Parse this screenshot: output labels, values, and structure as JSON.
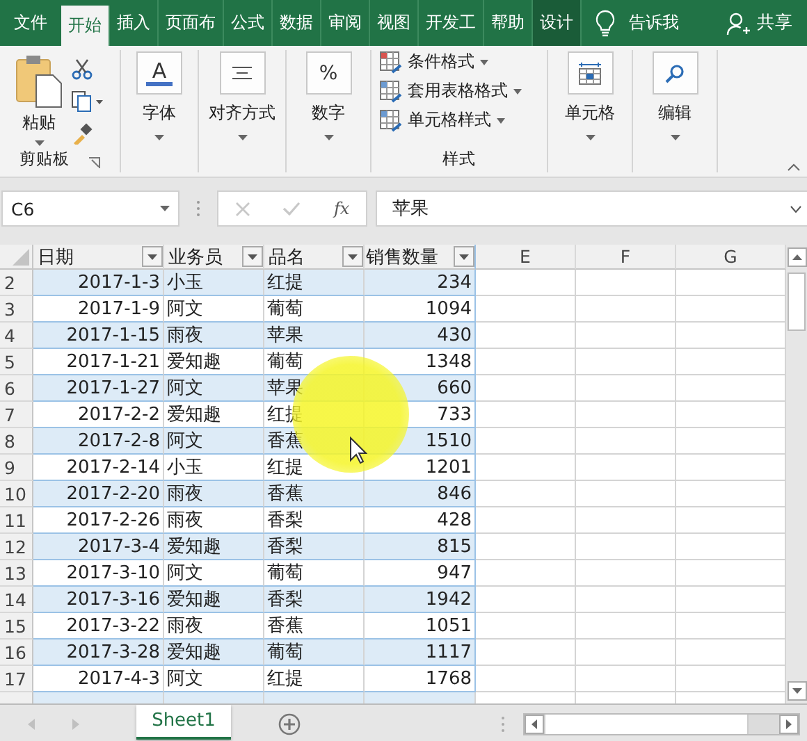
{
  "tabs": [
    {
      "label": "文件",
      "selected": false,
      "contextual": false
    },
    {
      "label": "开始",
      "selected": true,
      "contextual": false
    },
    {
      "label": "插入",
      "selected": false,
      "contextual": false
    },
    {
      "label": "页面布",
      "selected": false,
      "contextual": false
    },
    {
      "label": "公式",
      "selected": false,
      "contextual": false
    },
    {
      "label": "数据",
      "selected": false,
      "contextual": false
    },
    {
      "label": "审阅",
      "selected": false,
      "contextual": false
    },
    {
      "label": "视图",
      "selected": false,
      "contextual": false
    },
    {
      "label": "开发工",
      "selected": false,
      "contextual": false
    },
    {
      "label": "帮助",
      "selected": false,
      "contextual": false
    },
    {
      "label": "设计",
      "selected": false,
      "contextual": true
    }
  ],
  "tell_me": "告诉我",
  "share": "共享",
  "ribbon": {
    "clipboard": {
      "paste": "粘贴",
      "group_label": "剪贴板"
    },
    "font": {
      "glyph": "A",
      "label": "字体"
    },
    "alignment": {
      "label": "对齐方式"
    },
    "number": {
      "glyph": "%",
      "label": "数字"
    },
    "styles": {
      "items": [
        "条件格式",
        "套用表格格式",
        "单元格样式"
      ],
      "group_label": "样式"
    },
    "cells": {
      "label": "单元格"
    },
    "editing": {
      "label": "编辑"
    }
  },
  "name_box": "C6",
  "function_button": "fx",
  "formula": "苹果",
  "table_headers": [
    "日期",
    "业务员",
    "品名",
    "销售数量"
  ],
  "column_letters": [
    "E",
    "F",
    "G"
  ],
  "rows": [
    {
      "row": "2",
      "date": "2017-1-3",
      "person": "小玉",
      "product": "红提",
      "qty": "234"
    },
    {
      "row": "3",
      "date": "2017-1-9",
      "person": "阿文",
      "product": "葡萄",
      "qty": "1094"
    },
    {
      "row": "4",
      "date": "2017-1-15",
      "person": "雨夜",
      "product": "苹果",
      "qty": "430"
    },
    {
      "row": "5",
      "date": "2017-1-21",
      "person": "爱知趣",
      "product": "葡萄",
      "qty": "1348"
    },
    {
      "row": "6",
      "date": "2017-1-27",
      "person": "阿文",
      "product": "苹果",
      "qty": "660"
    },
    {
      "row": "7",
      "date": "2017-2-2",
      "person": "爱知趣",
      "product": "红提",
      "qty": "733"
    },
    {
      "row": "8",
      "date": "2017-2-8",
      "person": "阿文",
      "product": "香蕉",
      "qty": "1510"
    },
    {
      "row": "9",
      "date": "2017-2-14",
      "person": "小玉",
      "product": "红提",
      "qty": "1201"
    },
    {
      "row": "10",
      "date": "2017-2-20",
      "person": "雨夜",
      "product": "香蕉",
      "qty": "846"
    },
    {
      "row": "11",
      "date": "2017-2-26",
      "person": "雨夜",
      "product": "香梨",
      "qty": "428"
    },
    {
      "row": "12",
      "date": "2017-3-4",
      "person": "爱知趣",
      "product": "香梨",
      "qty": "815"
    },
    {
      "row": "13",
      "date": "2017-3-10",
      "person": "阿文",
      "product": "葡萄",
      "qty": "947"
    },
    {
      "row": "14",
      "date": "2017-3-16",
      "person": "爱知趣",
      "product": "香梨",
      "qty": "1942"
    },
    {
      "row": "15",
      "date": "2017-3-22",
      "person": "雨夜",
      "product": "香蕉",
      "qty": "1051"
    },
    {
      "row": "16",
      "date": "2017-3-28",
      "person": "爱知趣",
      "product": "葡萄",
      "qty": "1117"
    },
    {
      "row": "17",
      "date": "2017-4-3",
      "person": "阿文",
      "product": "红提",
      "qty": "1768"
    }
  ],
  "sheet_tabs": [
    {
      "label": "Sheet1",
      "selected": true
    }
  ]
}
